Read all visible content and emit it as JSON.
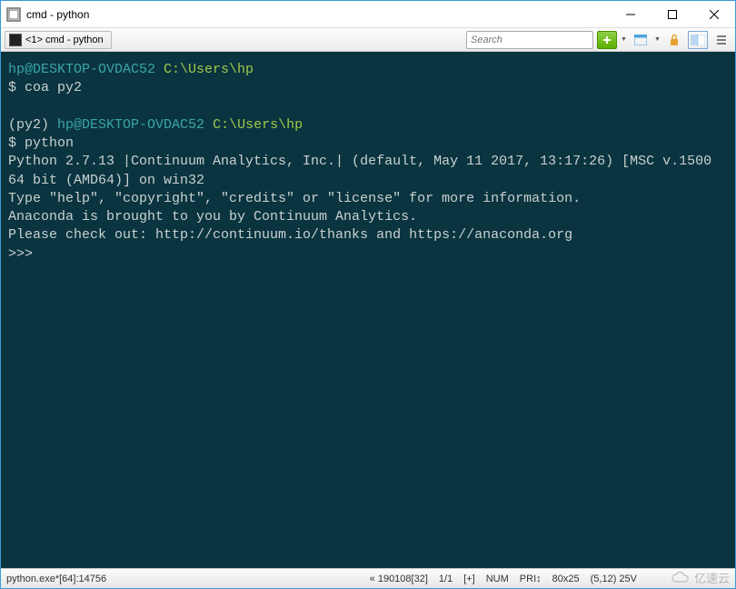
{
  "window": {
    "title": "cmd - python"
  },
  "toolbar": {
    "tab_label": "<1> cmd - python",
    "search_placeholder": "Search"
  },
  "terminal": {
    "l1_user": "hp@DESKTOP-OVDAC52",
    "l1_path": "C:\\Users\\hp",
    "l2_prompt": "$ ",
    "l2_cmd": "coa py2",
    "l3_env": "(py2) ",
    "l3_user": "hp@DESKTOP-OVDAC52",
    "l3_path": "C:\\Users\\hp",
    "l4_prompt": "$ ",
    "l4_cmd": "python",
    "l5": "Python 2.7.13 |Continuum Analytics, Inc.| (default, May 11 2017, 13:17:26) [MSC v.1500 64 bit (AMD64)] on win32",
    "l6": "Type \"help\", \"copyright\", \"credits\" or \"license\" for more information.",
    "l7": "Anaconda is brought to you by Continuum Analytics.",
    "l8": "Please check out: http://continuum.io/thanks and https://anaconda.org",
    "l9": ">>>"
  },
  "status": {
    "proc": "python.exe*[64]:14756",
    "pos": "« 190108[32]",
    "line": "1/1",
    "plus": "[+]",
    "num": "NUM",
    "pri": "PRI↕",
    "dim": "80x25",
    "cursor": "(5,12) 25V"
  },
  "watermark": "亿速云"
}
